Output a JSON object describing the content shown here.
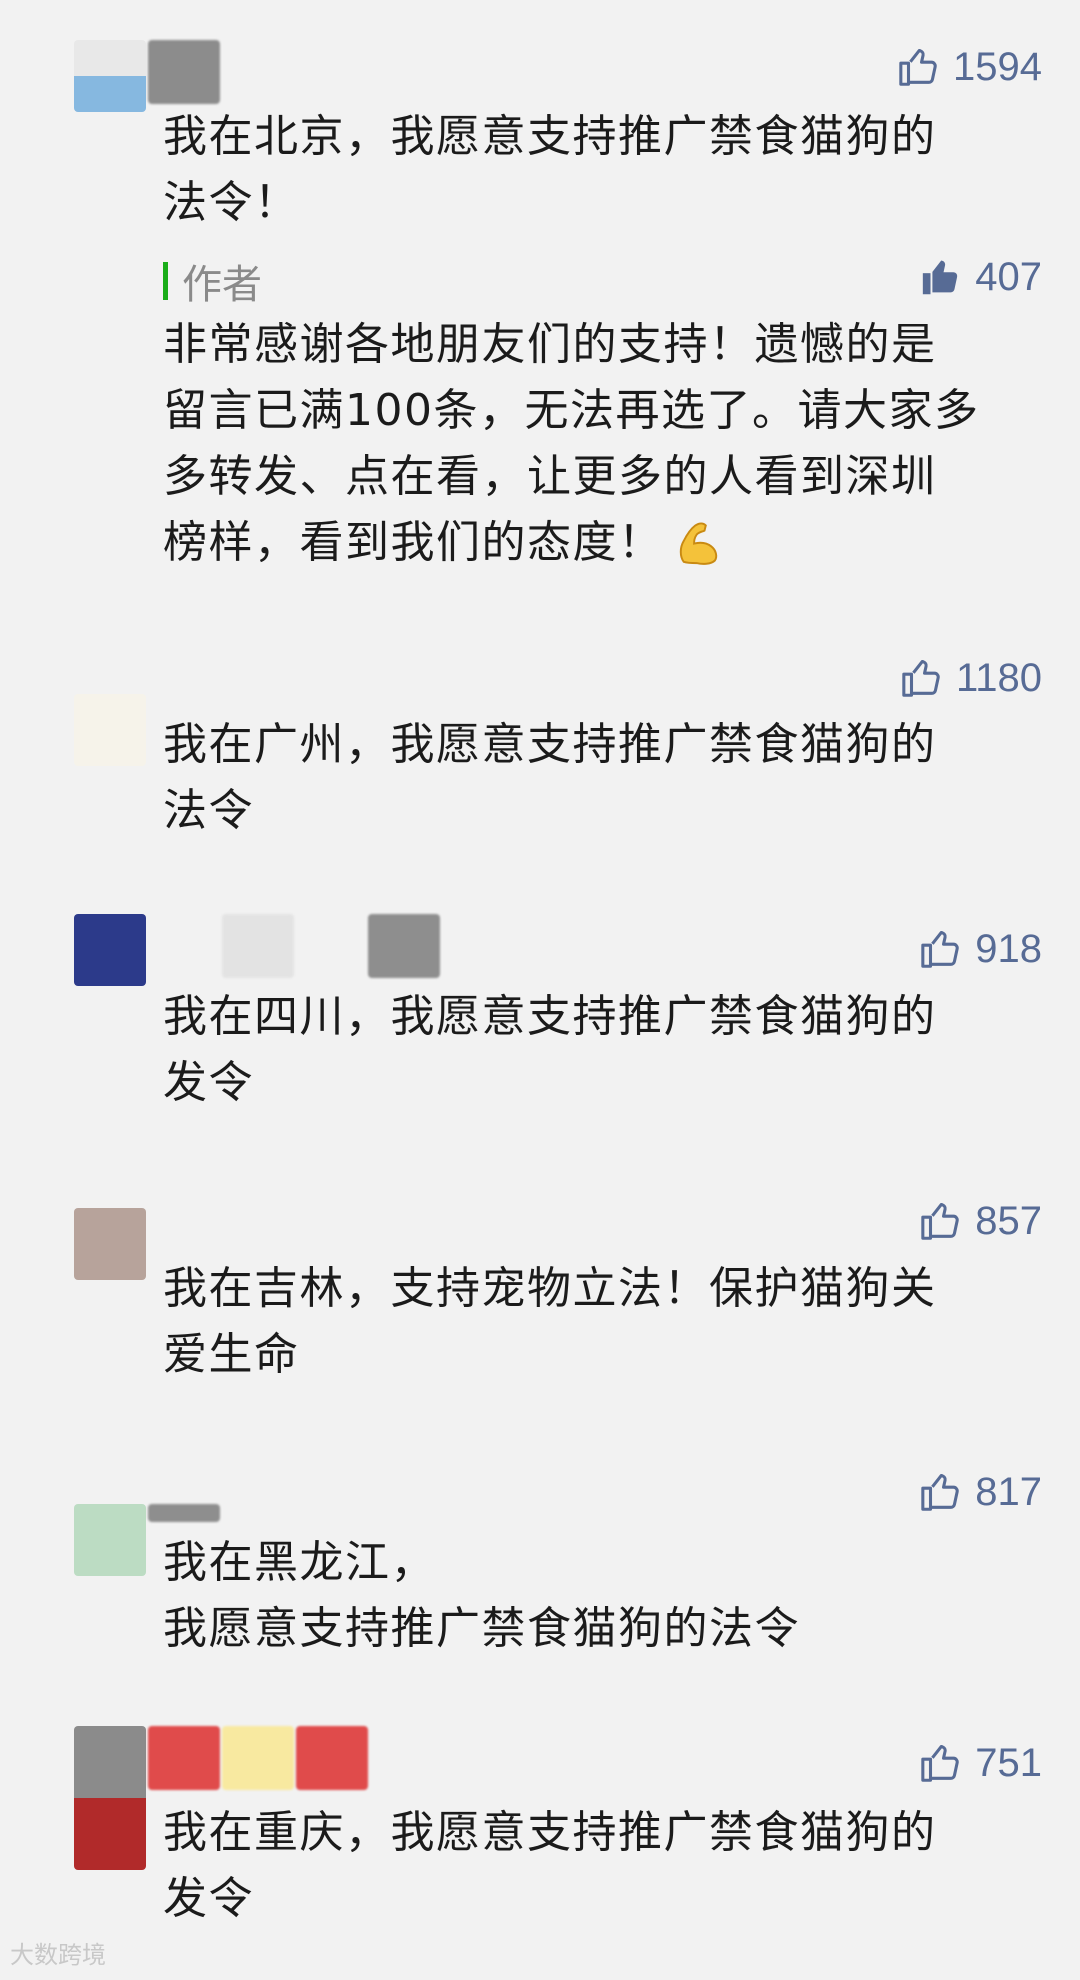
{
  "comments": [
    {
      "likes": "1594",
      "text": "我在北京，我愿意支持推广禁食猫狗的\n法令！",
      "reply": {
        "label": "作者",
        "likes": "407",
        "text": "非常感谢各地朋友们的支持！遗憾的是\n留言已满100条，无法再选了。请大家多\n多转发、点在看，让更多的人看到深圳\n榜样，看到我们的态度！"
      }
    },
    {
      "likes": "1180",
      "text": "我在广州，我愿意支持推广禁食猫狗的\n法令"
    },
    {
      "likes": "918",
      "text": "我在四川，我愿意支持推广禁食猫狗的\n发令"
    },
    {
      "likes": "857",
      "text": "我在吉林，支持宠物立法！保护猫狗关\n爱生命"
    },
    {
      "likes": "817",
      "text": "我在黑龙江，\n我愿意支持推广禁食猫狗的法令"
    },
    {
      "likes": "751",
      "text": "我在重庆，我愿意支持推广禁食猫狗的\n发令"
    }
  ],
  "icons": {
    "like": "thumbs-up-outline-icon",
    "like_filled": "thumbs-up-filled-icon",
    "emoji": "flexed-biceps-emoji"
  },
  "colors": {
    "like_text": "#576b95",
    "reply_bar": "#1aad19",
    "background": "#f2f2f2"
  },
  "watermark": "大数跨境"
}
